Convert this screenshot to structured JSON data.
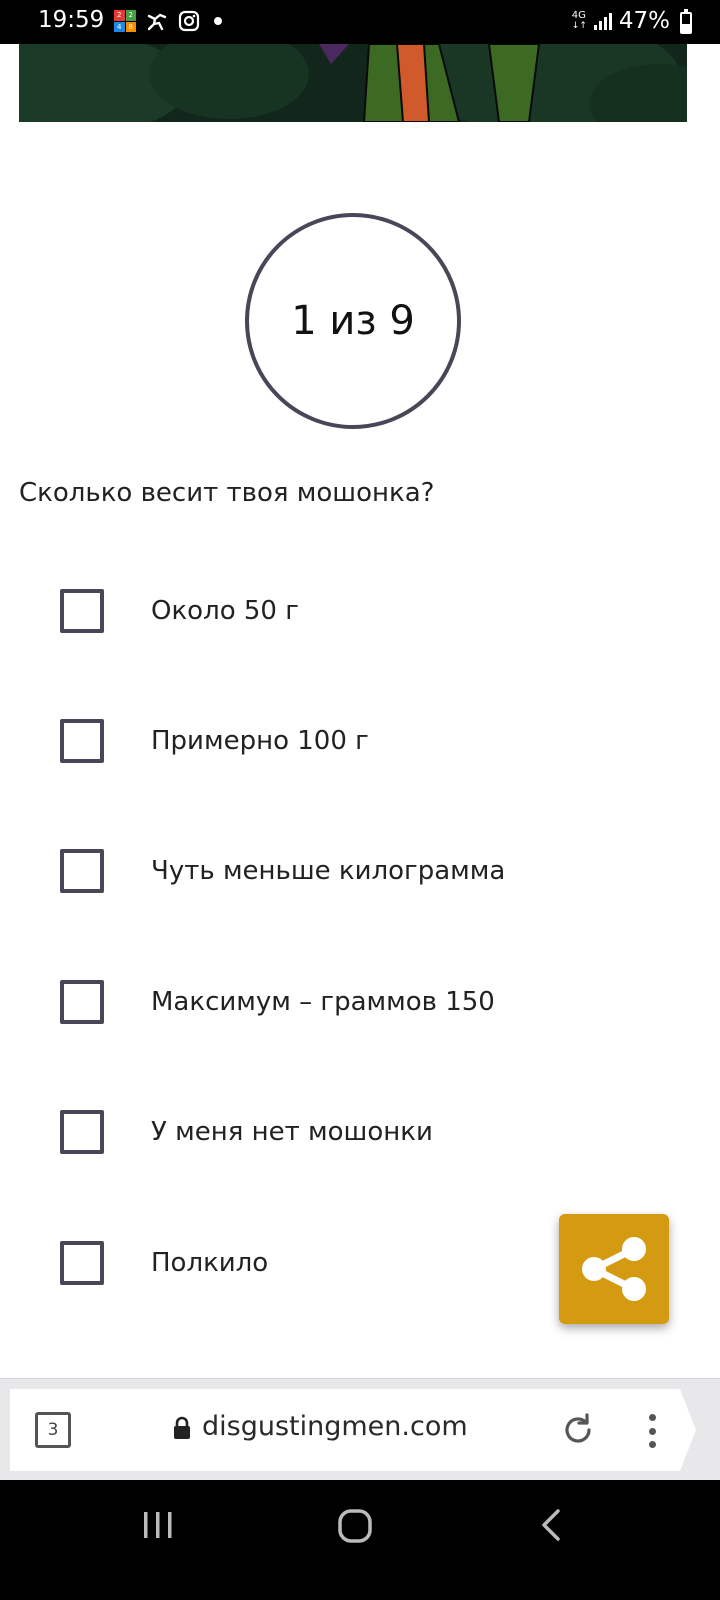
{
  "status_bar": {
    "time": "19:59",
    "network": "4G",
    "battery": "47%"
  },
  "quiz": {
    "progress": "1 из 9",
    "question": "Сколько весит твоя мошонка?",
    "options": [
      {
        "label": "Около 50 г",
        "checked": false
      },
      {
        "label": "Примерно 100 г",
        "checked": false
      },
      {
        "label": "Чуть меньше килограмма",
        "checked": false
      },
      {
        "label": "Максимум – граммов 150",
        "checked": false
      },
      {
        "label": "У меня нет мошонки",
        "checked": false
      },
      {
        "label": "Полкило",
        "checked": false
      }
    ]
  },
  "browser": {
    "tab_count": "3",
    "url": "disgustingmen.com"
  },
  "colors": {
    "accent": "#d49b12",
    "border": "#4a4658"
  },
  "icons": {
    "share": "share-icon",
    "lock": "lock-icon",
    "reload": "reload-icon",
    "more": "more-vert-icon"
  }
}
